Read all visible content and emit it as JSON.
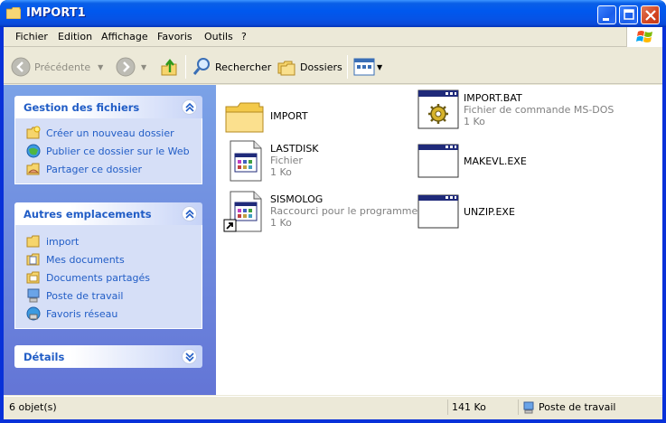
{
  "window": {
    "title": "IMPORT1"
  },
  "menu": {
    "items": [
      "Fichier",
      "Edition",
      "Affichage",
      "Favoris",
      "Outils",
      "?"
    ]
  },
  "toolbar": {
    "back_label": "Précédente",
    "search_label": "Rechercher",
    "folders_label": "Dossiers"
  },
  "sidebar": {
    "file_tasks": {
      "title": "Gestion des fichiers",
      "items": [
        "Créer un nouveau dossier",
        "Publier ce dossier sur le Web",
        "Partager ce dossier"
      ]
    },
    "other_places": {
      "title": "Autres emplacements",
      "items": [
        "import",
        "Mes documents",
        "Documents partagés",
        "Poste de travail",
        "Favoris réseau"
      ]
    },
    "details": {
      "title": "Détails"
    }
  },
  "files": [
    {
      "name": "IMPORT",
      "type": "",
      "size": "",
      "icon": "folder-icon"
    },
    {
      "name": "IMPORT.BAT",
      "type": "Fichier de commande MS-DOS",
      "size": "1 Ko",
      "icon": "batch-file-icon"
    },
    {
      "name": "LASTDISK",
      "type": "Fichier",
      "size": "1 Ko",
      "icon": "program-file-icon"
    },
    {
      "name": "MAKEVL.EXE",
      "type": "",
      "size": "",
      "icon": "exe-window-icon"
    },
    {
      "name": "SISMOLOG",
      "type": "Raccourci pour le programme ...",
      "size": "1 Ko",
      "icon": "shortcut-icon"
    },
    {
      "name": "UNZIP.EXE",
      "type": "",
      "size": "",
      "icon": "exe-window-icon"
    }
  ],
  "status": {
    "count": "6 objet(s)",
    "size": "141 Ko",
    "location": "Poste de travail"
  }
}
